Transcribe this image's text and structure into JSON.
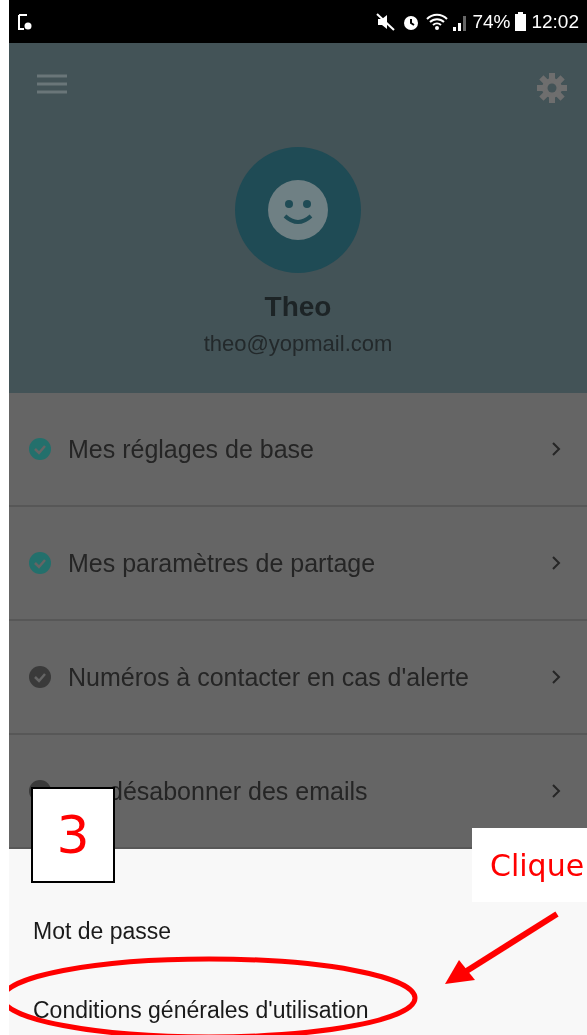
{
  "status_bar": {
    "battery": "74%",
    "time": "12:02"
  },
  "profile": {
    "name": "Theo",
    "email": "theo@yopmail.com"
  },
  "settings": [
    {
      "kind": "plain",
      "label": "Mes réglages de base",
      "checked": true
    },
    {
      "kind": "plain",
      "label": "Mes paramètres de partage",
      "checked": true
    },
    {
      "kind": "plain",
      "label": "Numéros à contacter en cas d'alerte",
      "checked": false
    },
    {
      "kind": "covered",
      "label": "désabonner des emails",
      "checked": false
    }
  ],
  "sheet_items": [
    "Mot de passe",
    "Conditions générales d'utilisation"
  ],
  "annotations": {
    "step_number": "3",
    "callout": "Clique"
  }
}
